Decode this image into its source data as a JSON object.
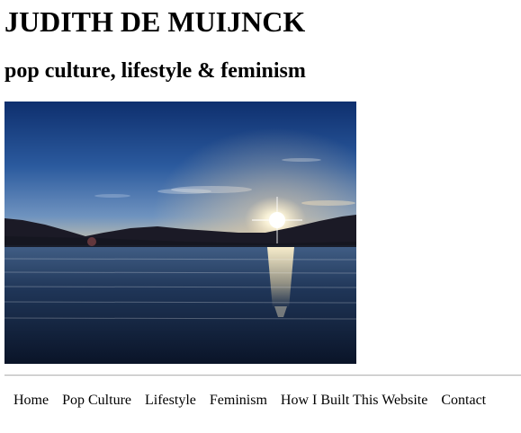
{
  "header": {
    "title": "JUDITH DE MUIJNCK",
    "tagline": "pop culture, lifestyle & feminism"
  },
  "hero": {
    "subject": "sunset over a lake with mountains"
  },
  "nav": {
    "items": [
      {
        "label": "Home"
      },
      {
        "label": "Pop Culture"
      },
      {
        "label": "Lifestyle"
      },
      {
        "label": "Feminism"
      },
      {
        "label": "How I Built This Website"
      },
      {
        "label": "Contact"
      }
    ]
  },
  "colors": {
    "background": "#ffffff",
    "text": "#000000",
    "divider": "#b9b9b9"
  }
}
